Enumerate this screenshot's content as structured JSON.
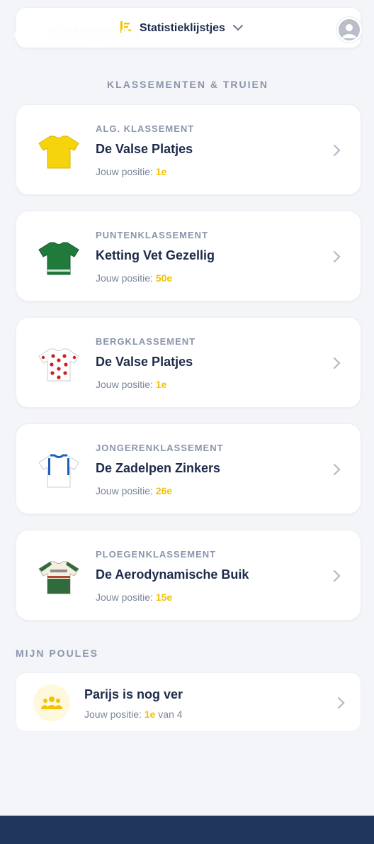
{
  "header": {
    "brand": "Wielerprono",
    "stats_label": "Statistieklijstjes"
  },
  "sections": {
    "classifications_title": "KLASSEMENTEN & TRUIEN",
    "pools_title": "MIJN POULES"
  },
  "position_label": "Jouw positie:",
  "classifications": [
    {
      "category": "ALG. KLASSEMENT",
      "team": "De Valse Platjes",
      "position": "1e",
      "jersey": "yellow-jersey-icon"
    },
    {
      "category": "PUNTENKLASSEMENT",
      "team": "Ketting Vet Gezellig",
      "position": "50e",
      "jersey": "green-jersey-icon"
    },
    {
      "category": "BERGKLASSEMENT",
      "team": "De Valse Platjes",
      "position": "1e",
      "jersey": "polka-dot-jersey-icon"
    },
    {
      "category": "JONGERENKLASSEMENT",
      "team": "De Zadelpen Zinkers",
      "position": "26e",
      "jersey": "white-jersey-icon"
    },
    {
      "category": "PLOEGENKLASSEMENT",
      "team": "De Aerodynamische Buik",
      "position": "15e",
      "jersey": "team-jersey-icon"
    }
  ],
  "pool": {
    "name": "Parijs is nog ver",
    "position": "1e",
    "of_text": "van 4"
  },
  "colors": {
    "accent": "#f2c300",
    "navy": "#1d2b4a",
    "muted": "#8a95ab",
    "background": "#f3f5f8"
  }
}
